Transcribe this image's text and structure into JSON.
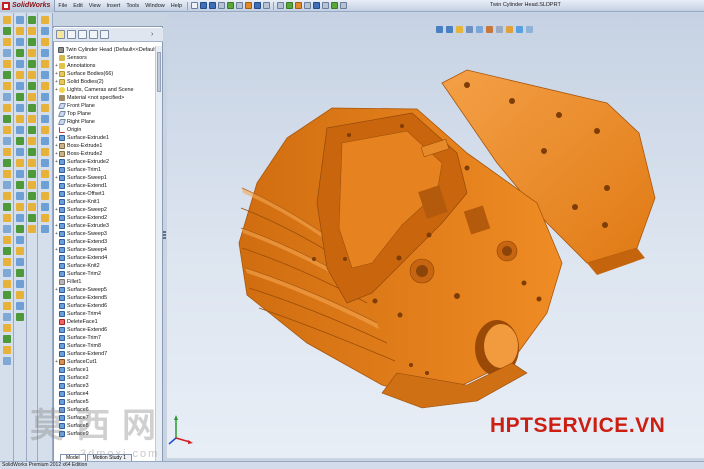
{
  "app": {
    "name": "SolidWorks",
    "document_title": "Twin Cylinder Head.SLDPRT"
  },
  "menu": [
    "File",
    "Edit",
    "View",
    "Insert",
    "Tools",
    "Window",
    "Help"
  ],
  "feature_tree": {
    "root": "Twin Cylinder Head  (Default<<Default",
    "items": [
      {
        "label": "Sensors",
        "icon": "sensor",
        "expandable": false
      },
      {
        "label": "Annotations",
        "icon": "annotation",
        "expandable": true
      },
      {
        "label": "Surface Bodies(66)",
        "icon": "folder",
        "expandable": true
      },
      {
        "label": "Solid Bodies(2)",
        "icon": "folder",
        "expandable": true
      },
      {
        "label": "Lights, Cameras and Scene",
        "icon": "light",
        "expandable": true
      },
      {
        "label": "Material <not specified>",
        "icon": "material",
        "expandable": false
      },
      {
        "label": "Front Plane",
        "icon": "plane",
        "expandable": false
      },
      {
        "label": "Top Plane",
        "icon": "plane",
        "expandable": false
      },
      {
        "label": "Right Plane",
        "icon": "plane",
        "expandable": false
      },
      {
        "label": "Origin",
        "icon": "origin",
        "expandable": false
      },
      {
        "label": "Surface-Extrude1",
        "icon": "surface",
        "expandable": true
      },
      {
        "label": "Boss-Extrude1",
        "icon": "boss",
        "expandable": true
      },
      {
        "label": "Boss-Extrude2",
        "icon": "boss",
        "expandable": true
      },
      {
        "label": "Surface-Extrude2",
        "icon": "surface",
        "expandable": true
      },
      {
        "label": "Surface-Trim1",
        "icon": "surface",
        "expandable": false
      },
      {
        "label": "Surface-Sweep1",
        "icon": "surface",
        "expandable": true
      },
      {
        "label": "Surface-Extend1",
        "icon": "surface",
        "expandable": false
      },
      {
        "label": "Surface-Offset1",
        "icon": "surface",
        "expandable": false
      },
      {
        "label": "Surface-Knit1",
        "icon": "surface",
        "expandable": false
      },
      {
        "label": "Surface-Sweep2",
        "icon": "surface",
        "expandable": true
      },
      {
        "label": "Surface-Extend2",
        "icon": "surface",
        "expandable": false
      },
      {
        "label": "Surface-Extrude3",
        "icon": "surface",
        "expandable": true
      },
      {
        "label": "Surface-Sweep3",
        "icon": "surface",
        "expandable": true
      },
      {
        "label": "Surface-Extend3",
        "icon": "surface",
        "expandable": false
      },
      {
        "label": "Surface-Sweep4",
        "icon": "surface",
        "expandable": true
      },
      {
        "label": "Surface-Extend4",
        "icon": "surface",
        "expandable": false
      },
      {
        "label": "Surface-Knit2",
        "icon": "surface",
        "expandable": false
      },
      {
        "label": "Surface-Trim2",
        "icon": "surface",
        "expandable": false
      },
      {
        "label": "Fillet1",
        "icon": "fillet",
        "expandable": false
      },
      {
        "label": "Surface-Sweep5",
        "icon": "surface",
        "expandable": true
      },
      {
        "label": "Surface-Extend5",
        "icon": "surface",
        "expandable": false
      },
      {
        "label": "Surface-Extend6",
        "icon": "surface",
        "expandable": false
      },
      {
        "label": "Surface-Trim4",
        "icon": "surface",
        "expandable": false
      },
      {
        "label": "DeleteFace1",
        "icon": "delete",
        "expandable": false
      },
      {
        "label": "Surface-Extend6",
        "icon": "surface",
        "expandable": false
      },
      {
        "label": "Surface-Trim7",
        "icon": "surface",
        "expandable": false
      },
      {
        "label": "Surface-Trim8",
        "icon": "surface",
        "expandable": false
      },
      {
        "label": "Surface-Extend7",
        "icon": "surface",
        "expandable": false
      },
      {
        "label": "SurfaceCut1",
        "icon": "cut",
        "expandable": true
      },
      {
        "label": "Surface1",
        "icon": "surface",
        "expandable": false
      },
      {
        "label": "Surface2",
        "icon": "surface",
        "expandable": false
      },
      {
        "label": "Surface3",
        "icon": "surface",
        "expandable": false
      },
      {
        "label": "Surface4",
        "icon": "surface",
        "expandable": false
      },
      {
        "label": "Surface5",
        "icon": "surface",
        "expandable": false
      },
      {
        "label": "Surface6",
        "icon": "surface",
        "expandable": false
      },
      {
        "label": "Surface7",
        "icon": "surface",
        "expandable": false
      },
      {
        "label": "Surface8",
        "icon": "surface",
        "expandable": false
      },
      {
        "label": "Surface9",
        "icon": "surface",
        "expandable": false
      }
    ]
  },
  "model_tabs": [
    "Model",
    "Motion Study 1"
  ],
  "status": {
    "text": "SolidWorks Premium 2012 x64 Edition"
  },
  "watermark": {
    "brand": "HPTSERVICE.VN",
    "cn": "莫西网",
    "url": "3dmoxi.com"
  },
  "colors": {
    "part": "#e8801c",
    "part_dark": "#b45a0c",
    "background": "#d8e1ee"
  }
}
